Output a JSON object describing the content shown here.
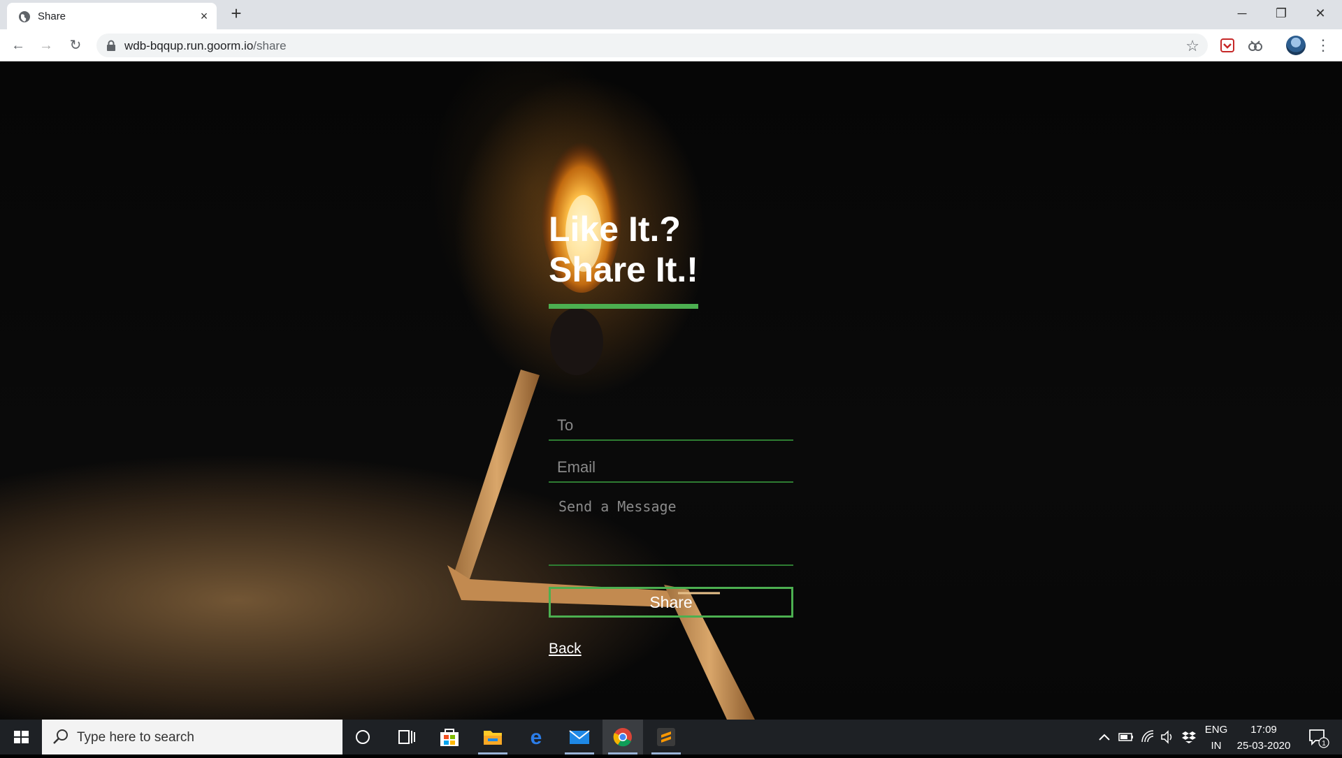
{
  "browser": {
    "tab_title": "Share",
    "tab_close": "×",
    "new_tab": "+",
    "url_host": "wdb-bqqup.run.goorm.io",
    "url_path": "/share",
    "window": {
      "minimize": "─",
      "restore": "❐",
      "close": "✕"
    },
    "nav": {
      "back": "←",
      "forward": "→",
      "reload": "↻"
    },
    "star": "☆",
    "menu": "⋮"
  },
  "page": {
    "headline_line1": "Like It.?",
    "headline_line2": "Share It.!",
    "to_placeholder": "To",
    "email_placeholder": "Email",
    "message_placeholder": "Send a Message",
    "share_label": "Share",
    "back_label": "Back",
    "accent_color": "#4caf50"
  },
  "taskbar": {
    "search_placeholder": "Type here to search",
    "lang_top": "ENG",
    "lang_bottom": "IN",
    "time": "17:09",
    "date": "25-03-2020",
    "notif_count": "1",
    "pinned": [
      "cortana-icon",
      "task-view-icon",
      "microsoft-store-icon",
      "file-explorer-icon",
      "edge-icon",
      "mail-icon",
      "chrome-icon",
      "sublime-text-icon"
    ]
  }
}
